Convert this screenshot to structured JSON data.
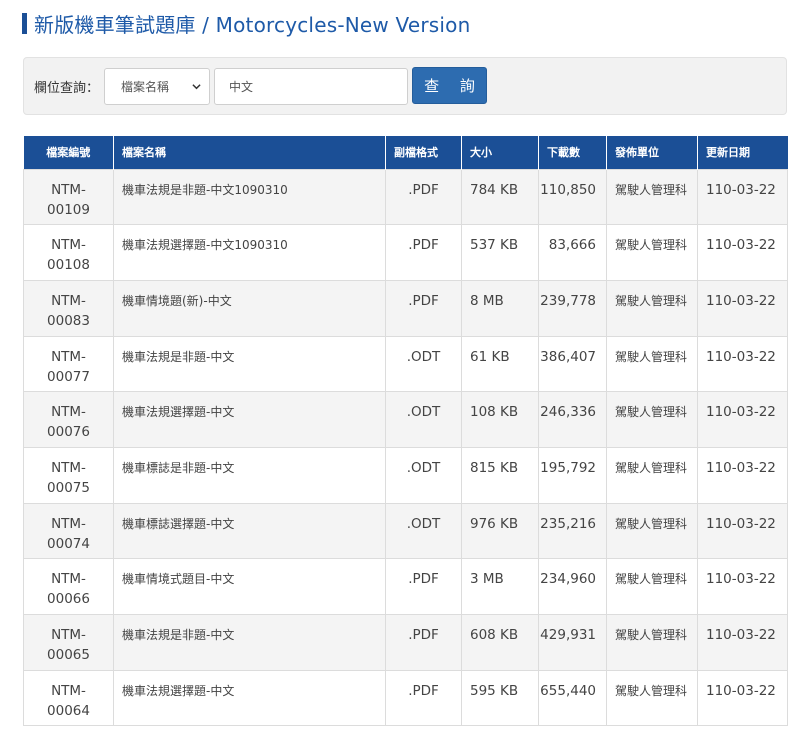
{
  "page_title": "新版機車筆試題庫 / Motorcycles-New Version",
  "search": {
    "label": "欄位查詢：",
    "field_selected": "檔案名稱",
    "keyword_value": "中文",
    "query_button": "查 詢"
  },
  "table": {
    "headers": [
      "檔案編號",
      "檔案名稱",
      "副檔格式",
      "大小",
      "下載數",
      "發佈單位",
      "更新日期"
    ],
    "rows": [
      {
        "id_1": "NTM-",
        "id_2": "00109",
        "name": "機車法規是非題-中文1090310",
        "format": ".PDF",
        "size": "784 KB",
        "downloads": "110,850",
        "unit": "駕駛人管理科",
        "date": "110-03-22"
      },
      {
        "id_1": "NTM-",
        "id_2": "00108",
        "name": "機車法規選擇題-中文1090310",
        "format": ".PDF",
        "size": "537 KB",
        "downloads": "83,666",
        "unit": "駕駛人管理科",
        "date": "110-03-22"
      },
      {
        "id_1": "NTM-",
        "id_2": "00083",
        "name": "機車情境題(新)-中文",
        "format": ".PDF",
        "size": "8 MB",
        "downloads": "239,778",
        "unit": "駕駛人管理科",
        "date": "110-03-22"
      },
      {
        "id_1": "NTM-",
        "id_2": "00077",
        "name": "機車法規是非題-中文",
        "format": ".ODT",
        "size": "61 KB",
        "downloads": "386,407",
        "unit": "駕駛人管理科",
        "date": "110-03-22"
      },
      {
        "id_1": "NTM-",
        "id_2": "00076",
        "name": "機車法規選擇題-中文",
        "format": ".ODT",
        "size": "108 KB",
        "downloads": "246,336",
        "unit": "駕駛人管理科",
        "date": "110-03-22"
      },
      {
        "id_1": "NTM-",
        "id_2": "00075",
        "name": "機車標誌是非題-中文",
        "format": ".ODT",
        "size": "815 KB",
        "downloads": "195,792",
        "unit": "駕駛人管理科",
        "date": "110-03-22"
      },
      {
        "id_1": "NTM-",
        "id_2": "00074",
        "name": "機車標誌選擇題-中文",
        "format": ".ODT",
        "size": "976 KB",
        "downloads": "235,216",
        "unit": "駕駛人管理科",
        "date": "110-03-22"
      },
      {
        "id_1": "NTM-",
        "id_2": "00066",
        "name": "機車情境式題目-中文",
        "format": ".PDF",
        "size": "3 MB",
        "downloads": "234,960",
        "unit": "駕駛人管理科",
        "date": "110-03-22"
      },
      {
        "id_1": "NTM-",
        "id_2": "00065",
        "name": "機車法規是非題-中文",
        "format": ".PDF",
        "size": "608 KB",
        "downloads": "429,931",
        "unit": "駕駛人管理科",
        "date": "110-03-22"
      },
      {
        "id_1": "NTM-",
        "id_2": "00064",
        "name": "機車法規選擇題-中文",
        "format": ".PDF",
        "size": "595 KB",
        "downloads": "655,440",
        "unit": "駕駛人管理科",
        "date": "110-03-22"
      }
    ]
  }
}
